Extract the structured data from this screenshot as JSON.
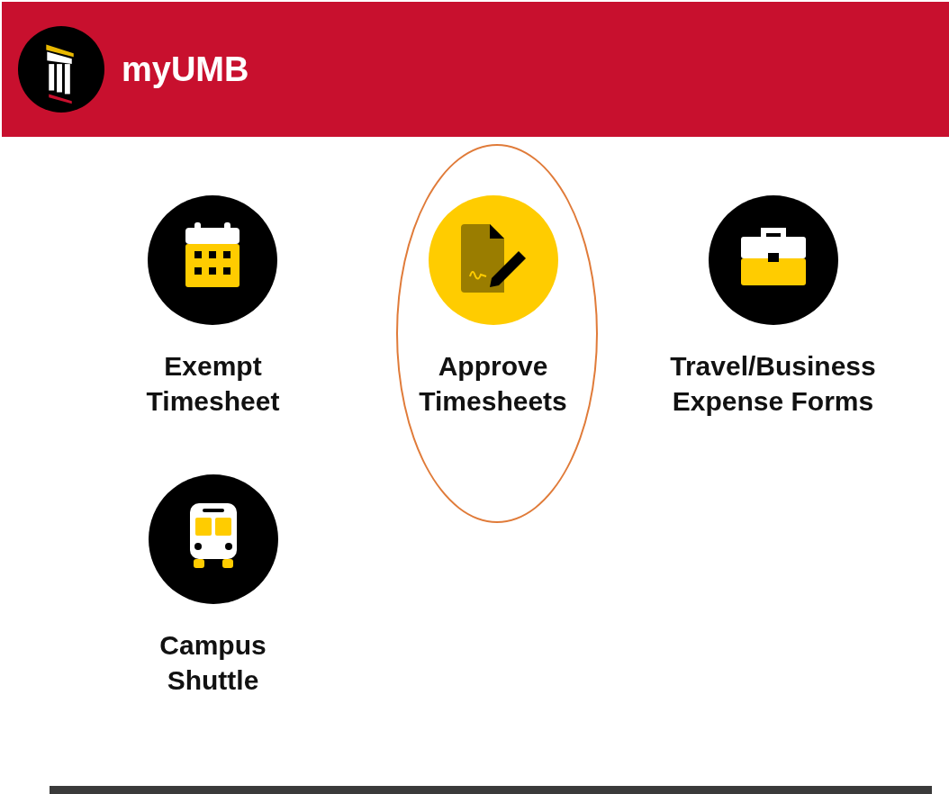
{
  "header": {
    "title": "myUMB"
  },
  "tiles": [
    {
      "kind": "calendar",
      "label": [
        "Exempt",
        "Timesheet"
      ],
      "selected": false,
      "circled": false
    },
    {
      "kind": "document",
      "label": [
        "Approve",
        "Timesheets"
      ],
      "selected": true,
      "circled": true
    },
    {
      "kind": "briefcase",
      "label": [
        "Travel/Business",
        "Expense Forms"
      ],
      "selected": false,
      "circled": false
    },
    {
      "kind": "bus",
      "label": [
        "Campus",
        "Shuttle"
      ],
      "selected": false,
      "circled": false
    }
  ]
}
